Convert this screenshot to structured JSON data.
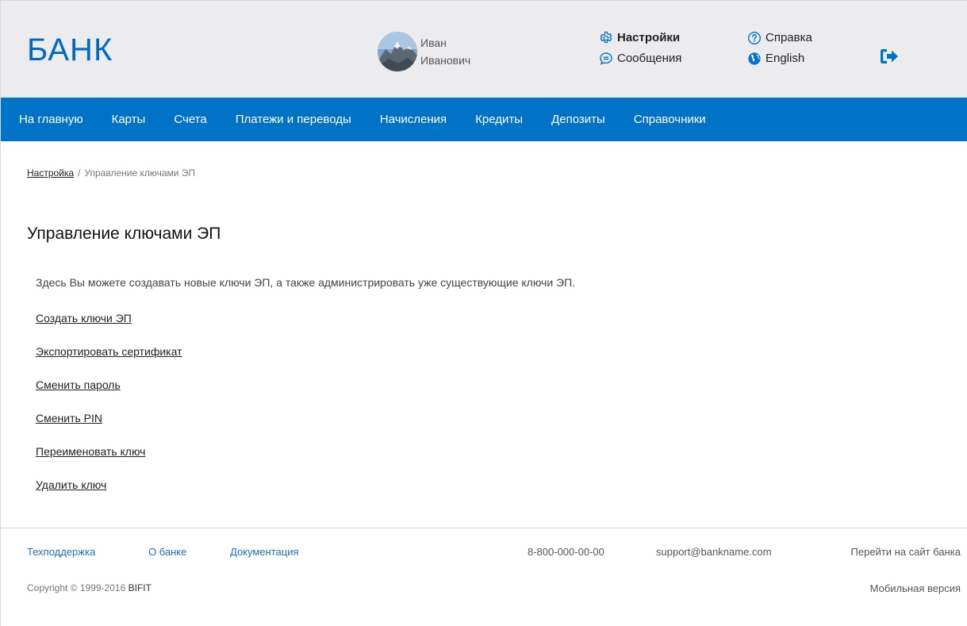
{
  "header": {
    "logo": "БАНК",
    "user": {
      "first_name": "Иван",
      "last_name": "Иванович"
    },
    "links": {
      "settings": "Настройки",
      "messages": "Сообщения",
      "help": "Справка",
      "language": "English"
    },
    "icons": {
      "settings": "gear-icon",
      "messages": "chat-icon",
      "help": "question-icon",
      "language": "globe-icon",
      "logout": "logout-icon"
    }
  },
  "nav": {
    "items": [
      "На главную",
      "Карты",
      "Счета",
      "Платежи и переводы",
      "Начисления",
      "Кредиты",
      "Депозиты",
      "Справочники"
    ]
  },
  "breadcrumb": {
    "parent": "Настройка",
    "separator": "/",
    "current": "Управление ключами ЭП"
  },
  "main": {
    "title": "Управление ключами ЭП",
    "description": "Здесь Вы можете создавать новые ключи ЭП, а также администрировать уже существующие ключи ЭП.",
    "actions": [
      "Создать ключи ЭП",
      "Экспортировать сертификат",
      "Сменить пароль",
      "Сменить PIN",
      "Переименовать ключ",
      "Удалить ключ"
    ]
  },
  "footer": {
    "support": "Техподдержка",
    "about": "О банке",
    "docs": "Документация",
    "phone": "8-800-000-00-00",
    "email": "support@bankname.com",
    "site": "Перейти на сайт банка",
    "copyright": "Copyright © 1999-2016",
    "copyright_brand": "BIFIT",
    "mobile": "Мобильная версия"
  },
  "colors": {
    "brand_blue": "#0073c6",
    "logo_blue": "#0069c0",
    "header_bg": "#ecebee",
    "footer_link": "#1f6fbf"
  }
}
